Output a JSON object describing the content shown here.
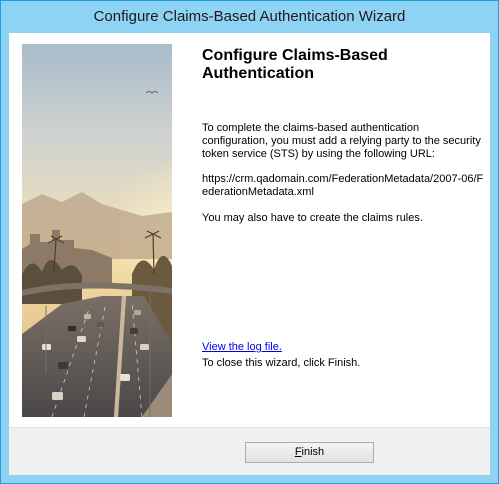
{
  "window": {
    "title": "Configure Claims-Based Authentication Wizard"
  },
  "page": {
    "heading": "Configure Claims-Based Authentication",
    "paragraph1": "To complete the claims-based authentication configuration, you must add a relying party to the security token service (STS) by using the following URL:",
    "url": "https://crm.qadomain.com/FederationMetadata/2007-06/FederationMetadata.xml",
    "paragraph2": "You may also have to create the claims rules.",
    "log_link": "View the log file.",
    "close_instruction": "To close this wizard, click Finish."
  },
  "buttons": {
    "finish": {
      "mnemonic": "F",
      "rest": "inish"
    }
  },
  "colors": {
    "title_bar": "#8fd3f4",
    "window_border": "#1ba1e2",
    "link": "#0000ee"
  },
  "icons": {
    "side_image": "city-highway-sunset-image"
  }
}
